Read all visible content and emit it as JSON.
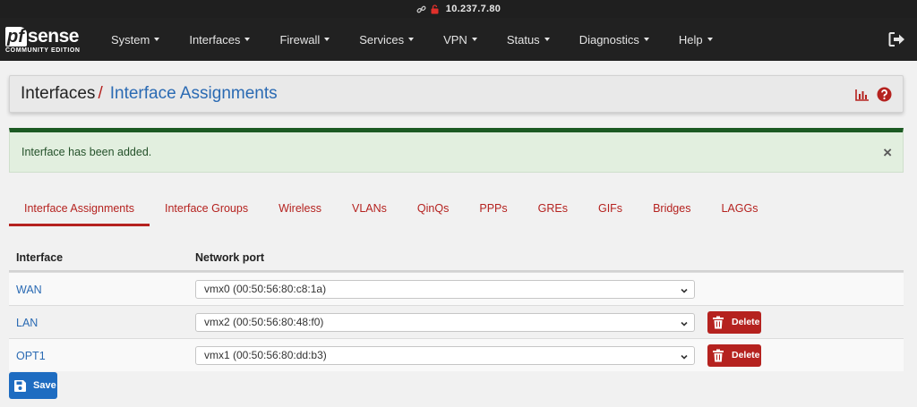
{
  "address_bar": {
    "url": "10.237.7.80"
  },
  "brand": {
    "logo_pf": "pf",
    "logo_sense": "sense",
    "edition": "COMMUNITY EDITION"
  },
  "nav": {
    "items": [
      {
        "label": "System"
      },
      {
        "label": "Interfaces"
      },
      {
        "label": "Firewall"
      },
      {
        "label": "Services"
      },
      {
        "label": "VPN"
      },
      {
        "label": "Status"
      },
      {
        "label": "Diagnostics"
      },
      {
        "label": "Help"
      }
    ],
    "logout_icon": "sign-out-icon"
  },
  "page_header": {
    "crumb_parent": "Interfaces",
    "separator": "/",
    "crumb_current": "Interface Assignments",
    "icons": [
      "bar-chart-icon",
      "help-circle-icon"
    ]
  },
  "alert": {
    "message": "Interface has been added.",
    "close": "×"
  },
  "tabs": [
    {
      "label": "Interface Assignments",
      "active": true
    },
    {
      "label": "Interface Groups"
    },
    {
      "label": "Wireless"
    },
    {
      "label": "VLANs"
    },
    {
      "label": "QinQs"
    },
    {
      "label": "PPPs"
    },
    {
      "label": "GREs"
    },
    {
      "label": "GIFs"
    },
    {
      "label": "Bridges"
    },
    {
      "label": "LAGGs"
    }
  ],
  "table": {
    "headers": [
      "Interface",
      "Network port"
    ],
    "rows": [
      {
        "interface": "WAN",
        "port": "vmx0 (00:50:56:80:c8:1a)",
        "delete": null
      },
      {
        "interface": "LAN",
        "port": "vmx2 (00:50:56:80:48:f0)",
        "delete": "Delete"
      },
      {
        "interface": "OPT1",
        "port": "vmx1 (00:50:56:80:dd:b3)",
        "delete": "Delete"
      }
    ]
  },
  "save_button": {
    "label": "Save"
  },
  "colors": {
    "navbar": "#212121",
    "danger": "#b5221f",
    "link": "#2a6ab3",
    "primary": "#1e6cc1",
    "success_border": "#1c5a23",
    "success_bg": "#e2efdf"
  }
}
